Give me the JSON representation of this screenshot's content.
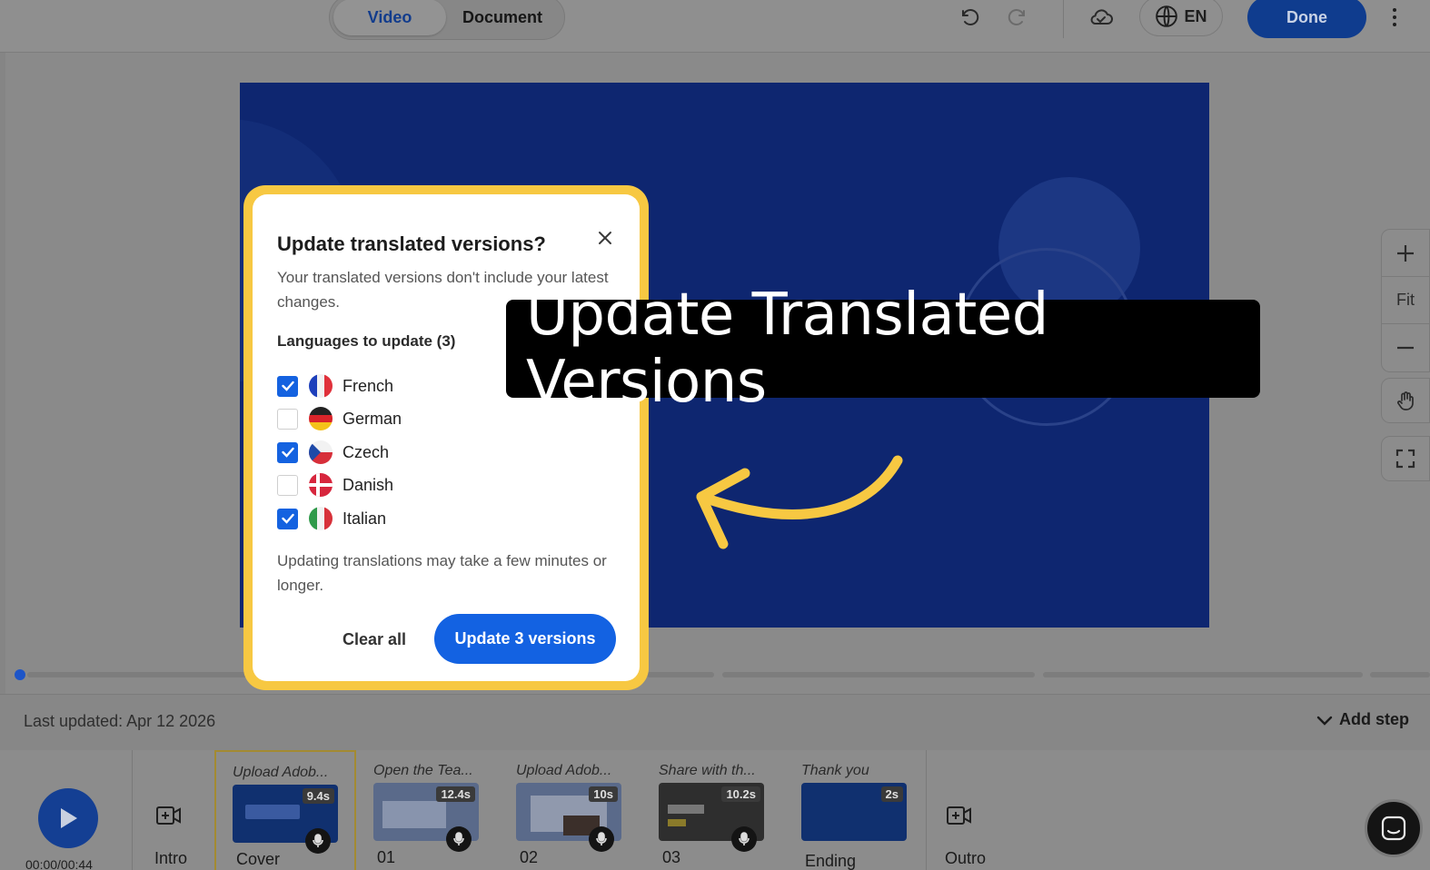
{
  "topbar": {
    "tabs": [
      "Video",
      "Document"
    ],
    "language": "EN",
    "done_label": "Done"
  },
  "zoom": {
    "fit_label": "Fit"
  },
  "timeline": {
    "last_updated": "Last updated: Apr 12 2026",
    "add_step": "Add step",
    "timecode": "00:00/00:44",
    "intro_label": "Intro",
    "outro_label": "Outro",
    "steps": [
      {
        "title": "Upload Adob...",
        "duration": "9.4s",
        "label": "Cover",
        "mic": true
      },
      {
        "title": "Open the Tea...",
        "duration": "12.4s",
        "label": "01",
        "mic": true
      },
      {
        "title": "Upload Adob...",
        "duration": "10s",
        "label": "02",
        "mic": true
      },
      {
        "title": "Share with th...",
        "duration": "10.2s",
        "label": "03",
        "mic": true
      },
      {
        "title": "Thank you",
        "duration": "2s",
        "label": "Ending",
        "mic": false
      }
    ]
  },
  "modal": {
    "title": "Update translated versions?",
    "description": "Your translated versions don't include your latest changes.",
    "languages_heading": "Languages to update (3)",
    "languages": [
      {
        "name": "French",
        "checked": true,
        "flag": "fr"
      },
      {
        "name": "German",
        "checked": false,
        "flag": "de"
      },
      {
        "name": "Czech",
        "checked": true,
        "flag": "cz"
      },
      {
        "name": "Danish",
        "checked": false,
        "flag": "dk"
      },
      {
        "name": "Italian",
        "checked": true,
        "flag": "it"
      }
    ],
    "note": "Updating translations may take a few minutes or longer.",
    "clear_label": "Clear all",
    "update_label": "Update 3 versions"
  },
  "callout": {
    "text": "Update Translated Versions"
  },
  "colors": {
    "accent": "#1362e2",
    "highlight": "#f7c842",
    "slide": "#0e2670"
  }
}
